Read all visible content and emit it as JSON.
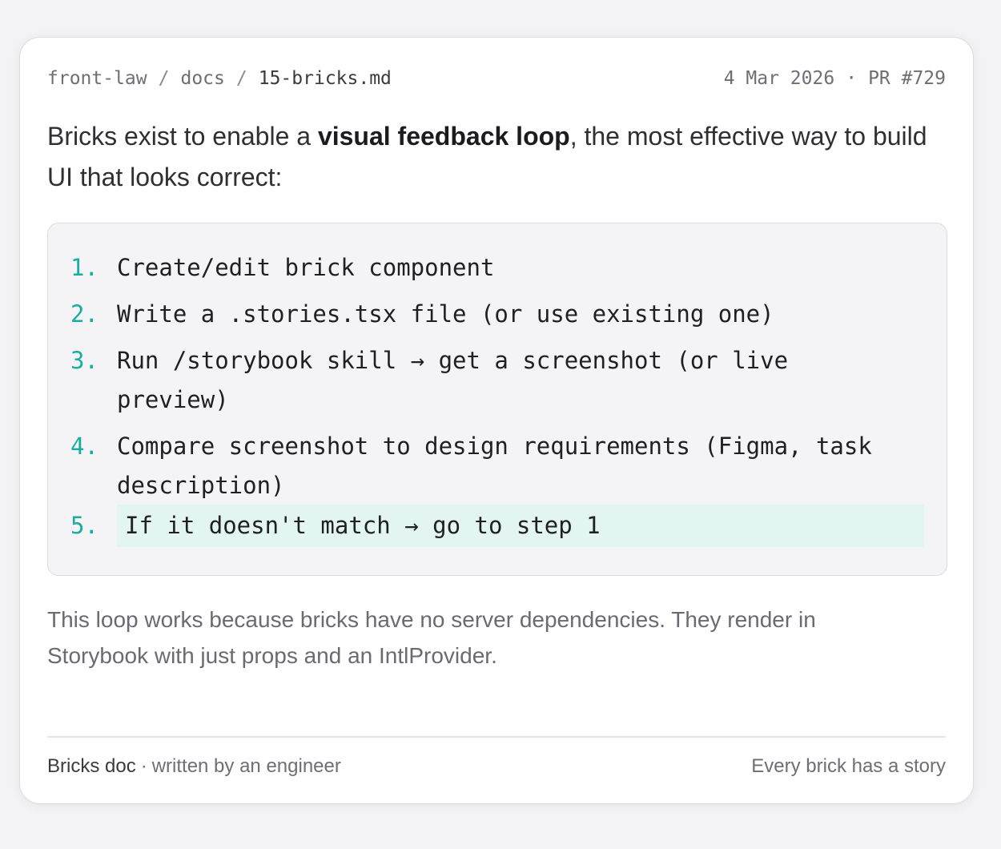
{
  "header": {
    "breadcrumbs": [
      "front-law",
      "docs",
      "15-bricks.md"
    ],
    "separator": "/",
    "date": "4 Mar 2026",
    "dot": "·",
    "pr": "PR #729"
  },
  "intro": {
    "before": "Bricks exist to enable a ",
    "emphasis": "visual feedback loop",
    "after": ", the most effective way to build UI that looks correct:"
  },
  "steps": [
    {
      "num": "1.",
      "text": "Create/edit brick component"
    },
    {
      "num": "2.",
      "text": "Write a .stories.tsx file (or use existing one)"
    },
    {
      "num": "3.",
      "text": "Run /storybook skill → get a screenshot (or live",
      "text2": "preview)"
    },
    {
      "num": "4.",
      "text": "Compare screenshot to design requirements (Figma, task",
      "text2": "description)"
    },
    {
      "num": "5.",
      "text": "If it doesn't match → go to step 1"
    }
  ],
  "outro": "This loop works because bricks have no server dependencies. They render in Storybook with just props and an IntlProvider.",
  "footer": {
    "doc_name": "Bricks doc",
    "dot": "·",
    "byline": "written by an engineer",
    "tagline": "Every brick has a story"
  },
  "colors": {
    "accent": "#1aaea0",
    "highlight": "#e2f5f1",
    "code_bg": "#f4f4f7"
  }
}
